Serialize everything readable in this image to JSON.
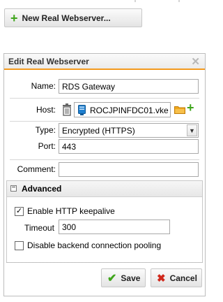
{
  "toolbar": {
    "new_button_label": "New Real Webserver..."
  },
  "dialog": {
    "title": "Edit Real Webserver",
    "close_glyph": "✕",
    "form": {
      "name_label": "Name:",
      "name_value": "RDS Gateway",
      "host_label": "Host:",
      "host_value": "ROCJPINFDC01.vke",
      "type_label": "Type:",
      "type_value": "Encrypted (HTTPS)",
      "port_label": "Port:",
      "port_value": "443",
      "comment_label": "Comment:",
      "comment_value": ""
    },
    "advanced": {
      "title": "Advanced",
      "expanded": true,
      "keepalive_label": "Enable HTTP keepalive",
      "keepalive_checked": true,
      "timeout_label": "Timeout",
      "timeout_value": "300",
      "pooling_label": "Disable backend connection pooling",
      "pooling_checked": false
    },
    "buttons": {
      "save_label": "Save",
      "cancel_label": "Cancel"
    }
  },
  "colors": {
    "accent": "#f39a1e",
    "add_green": "#3fa51c",
    "cancel_red": "#d0281c",
    "server_blue": "#1e7fcf",
    "folder_orange": "#f0a81c"
  },
  "icons": [
    "plus-icon",
    "trash-icon",
    "server-icon",
    "folder-icon",
    "add-icon",
    "close-icon",
    "collapse-icon",
    "check-icon",
    "cancel-icon",
    "dropdown-arrow-icon"
  ]
}
